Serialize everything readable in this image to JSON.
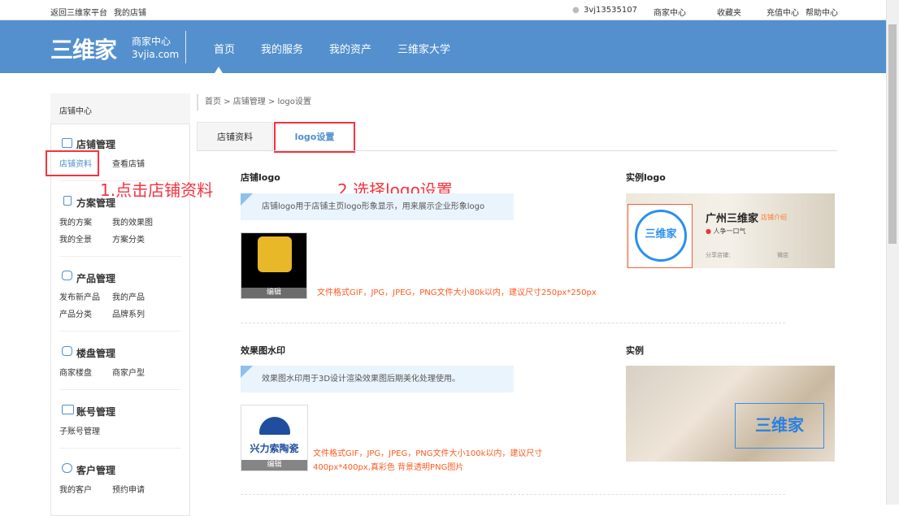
{
  "topbar": {
    "back": "返回三维家平台",
    "my_shop": "我的店铺",
    "user": "3vj13535107",
    "merchant_center": "商家中心",
    "favorites": "收藏夹",
    "recharge": "充值中心",
    "help": "帮助中心"
  },
  "header": {
    "logo": "三维家",
    "subtitle": "商家中心",
    "domain": "3vjia.com",
    "nav": [
      "首页",
      "我的服务",
      "我的资产",
      "三维家大学"
    ]
  },
  "sidebar": {
    "title": "店铺中心",
    "groups": [
      {
        "title": "店铺管理",
        "links": [
          "店铺资料",
          "查看店铺"
        ]
      },
      {
        "title": "方案管理",
        "links": [
          "我的方案",
          "我的效果图",
          "我的全景",
          "方案分类"
        ]
      },
      {
        "title": "产品管理",
        "links": [
          "发布新产品",
          "我的产品",
          "产品分类",
          "品牌系列"
        ]
      },
      {
        "title": "楼盘管理",
        "links": [
          "商家楼盘",
          "商家户型"
        ]
      },
      {
        "title": "账号管理",
        "links": [
          "子账号管理"
        ]
      },
      {
        "title": "客户管理",
        "links": [
          "我的客户",
          "预约申请"
        ]
      }
    ]
  },
  "breadcrumb": "首页 > 店铺管理 > logo设置",
  "tabs": [
    "店铺资料",
    "logo设置"
  ],
  "logo_section": {
    "title": "店铺logo",
    "tip": "店铺logo用于店铺主页logo形象显示，用来展示企业形象logo",
    "edit": "编辑",
    "note": "文件格式GIF，JPG，JPEG，PNG文件大小80k以内，建议尺寸250px*250px",
    "example_title": "实例logo",
    "example_shop": "广州三维家",
    "example_intro": "店铺介绍",
    "example_slogan": "人争一口气",
    "example_share": "分享店铺：",
    "example_wechat": "微店"
  },
  "watermark_section": {
    "title": "效果图水印",
    "tip": "效果图水印用于3D设计渲染效果图后期美化处理使用。",
    "edit": "编辑",
    "watermark_text": "兴力索陶瓷",
    "note": "文件格式GIF，JPG，JPEG，PNG文件大小100k以内，建议尺寸400px*400px,真彩色 背景透明PNG图片",
    "example_title": "实例"
  },
  "annotations": {
    "step1": "1.点击店铺资料",
    "step2": "2.选择logo设置"
  },
  "colors": {
    "header": "#5490cd",
    "annotation": "#f5333f",
    "note": "#ff5a1f"
  }
}
